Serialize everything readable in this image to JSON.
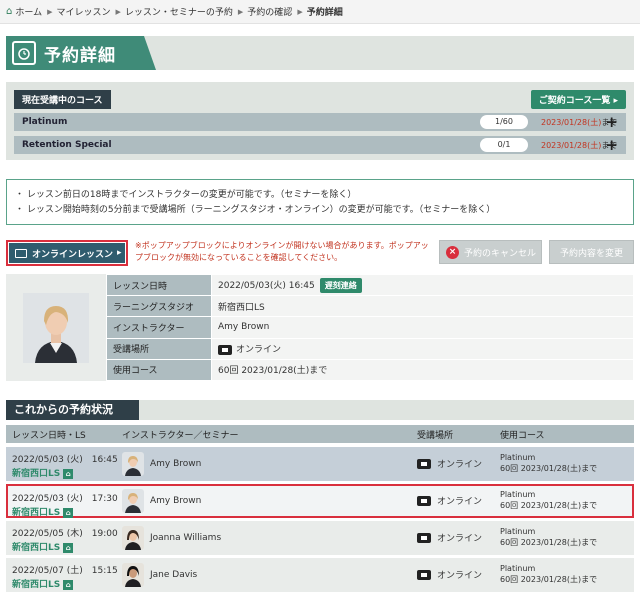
{
  "breadcrumb": {
    "items": [
      "ホーム",
      "マイレッスン",
      "レッスン・セミナーの予約",
      "予約の確認",
      "予約詳細"
    ]
  },
  "page": {
    "title": "予約詳細",
    "title_icon": "calendar-icon"
  },
  "courses": {
    "header_label": "現在受講中のコース",
    "list_button": "ご契約コース一覧",
    "items": [
      {
        "name": "Platinum",
        "count": "1/60",
        "until_date": "2023/01/28(土)",
        "until_suffix": "まで"
      },
      {
        "name": "Retention Special",
        "count": "0/1",
        "until_date": "2023/01/28(土)",
        "until_suffix": "まで"
      }
    ]
  },
  "notice": {
    "lines": [
      "・ レッスン前日の18時までインストラクターの変更が可能です。（セミナーを除く）",
      "・ レッスン開始時刻の5分前まで受講場所（ラーニングスタジオ・オンライン）の変更が可能です。（セミナーを除く）"
    ]
  },
  "actions": {
    "online_button": "オンラインレッスン",
    "popup_note": "※ポップアップブロックによりオンラインが開けない場合があります。ポップアップブロックが無効になっていることを確認してください。",
    "cancel_button": "予約のキャンセル",
    "change_button": "予約内容を変更"
  },
  "detail": {
    "rows": [
      {
        "key": "レッスン日時",
        "value": "2022/05/03(火) 16:45",
        "badge": "遅刻連絡"
      },
      {
        "key": "ラーニングスタジオ",
        "value": "新宿西口LS"
      },
      {
        "key": "インストラクター",
        "value": "Amy Brown"
      },
      {
        "key": "受講場所",
        "value": "オンライン"
      },
      {
        "key": "使用コース",
        "value": "60回 2023/01/28(土)まで"
      }
    ]
  },
  "upcoming": {
    "title": "これからの予約状況",
    "columns": [
      "レッスン日時・LS",
      "インストラクター／セミナー",
      "受講場所",
      "使用コース"
    ],
    "rows": [
      {
        "datetime": "2022/05/03 (火)　16:45",
        "ls": "新宿西口LS",
        "instructor": "Amy Brown",
        "place": "オンライン",
        "course": "Platinum",
        "course_detail": "60回 2023/01/28(土)まで"
      },
      {
        "datetime": "2022/05/03 (火)　17:30",
        "ls": "新宿西口LS",
        "instructor": "Amy Brown",
        "place": "オンライン",
        "course": "Platinum",
        "course_detail": "60回 2023/01/28(土)まで"
      },
      {
        "datetime": "2022/05/05 (木)　19:00",
        "ls": "新宿西口LS",
        "instructor": "Joanna Williams",
        "place": "オンライン",
        "course": "Platinum",
        "course_detail": "60回 2023/01/28(土)まで"
      },
      {
        "datetime": "2022/05/07 (土)　15:15",
        "ls": "新宿西口LS",
        "instructor": "Jane Davis",
        "place": "オンライン",
        "course": "Platinum",
        "course_detail": "60回 2023/01/28(土)まで"
      }
    ]
  },
  "colors": {
    "accent": "#2f8a6b",
    "alert": "#c2331f",
    "highlight_border": "#d92f3d"
  }
}
